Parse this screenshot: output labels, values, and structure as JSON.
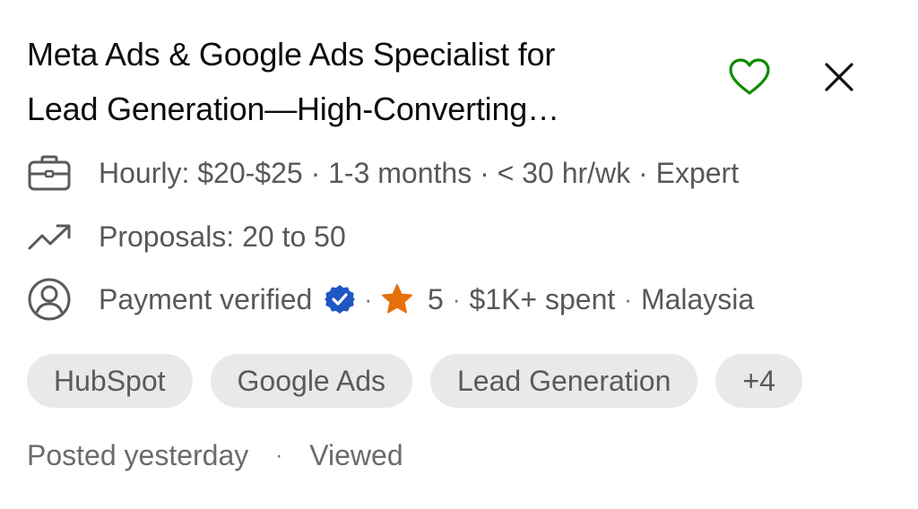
{
  "job": {
    "title_line1": "Meta Ads & Google Ads Specialist for",
    "title_line2": "Lead Generation—High-Converting…",
    "details": "Hourly: $20-$25 · 1-3 months · < 30 hr/wk · Expert",
    "proposals": "Proposals: 20 to 50",
    "client": {
      "payment": "Payment verified",
      "rating": "5",
      "spent": "$1K+ spent",
      "location": "Malaysia",
      "separator": "·"
    },
    "skills": [
      "HubSpot",
      "Google Ads",
      "Lead Generation",
      "+4"
    ],
    "posted": "Posted yesterday",
    "footer_separator": "·",
    "viewed": "Viewed"
  },
  "icons": {
    "save": "heart-icon",
    "dismiss": "close-icon",
    "details": "briefcase-icon",
    "proposals": "trending-up-icon",
    "client": "user-circle-icon",
    "verified": "verified-badge-icon",
    "rating": "star-icon"
  },
  "colors": {
    "heart": "#108a00",
    "verified": "#1f57c3",
    "star": "#e7700d",
    "chip_bg": "#e9e9e9"
  }
}
